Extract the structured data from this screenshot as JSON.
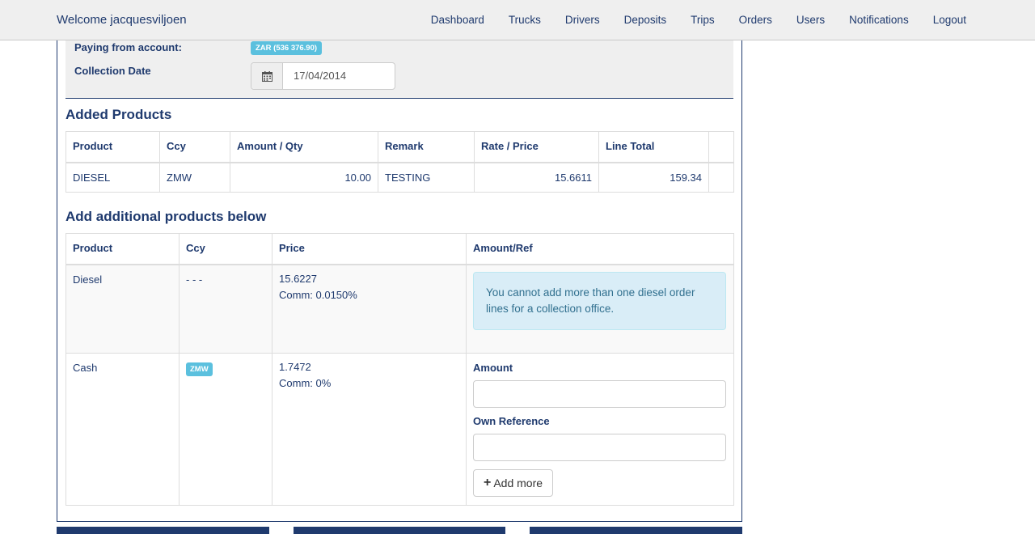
{
  "nav": {
    "welcome": "Welcome jacquesviljoen",
    "items": [
      "Dashboard",
      "Trucks",
      "Drivers",
      "Deposits",
      "Trips",
      "Orders",
      "Users",
      "Notifications",
      "Logout"
    ]
  },
  "form": {
    "paying_label": "Paying from account:",
    "account_badge": "ZAR (536 376.90)",
    "collection_label": "Collection Date",
    "collection_date": "17/04/2014"
  },
  "added": {
    "title": "Added Products",
    "headers": [
      "Product",
      "Ccy",
      "Amount / Qty",
      "Remark",
      "Rate / Price",
      "Line Total"
    ],
    "rows": [
      {
        "product": "DIESEL",
        "ccy": "ZMW",
        "amount": "10.00",
        "remark": "TESTING",
        "rate": "15.6611",
        "total": "159.34"
      }
    ]
  },
  "additional": {
    "title": "Add additional products below",
    "headers": [
      "Product",
      "Ccy",
      "Price",
      "Amount/Ref"
    ],
    "rows": [
      {
        "product": "Diesel",
        "ccy": "- - -",
        "price": "15.6227",
        "comm": "Comm: 0.0150%",
        "alert": "You cannot add more than one diesel order lines for a collection office."
      },
      {
        "product": "Cash",
        "ccy": "ZMW",
        "price": "1.7472",
        "comm": "Comm: 0%",
        "amount_label": "Amount",
        "ref_label": "Own Reference",
        "add_more": "Add more"
      }
    ]
  },
  "colors": {
    "primary": "#1f3a6e",
    "badge": "#5bc0de",
    "alert_bg": "#d9edf7"
  }
}
